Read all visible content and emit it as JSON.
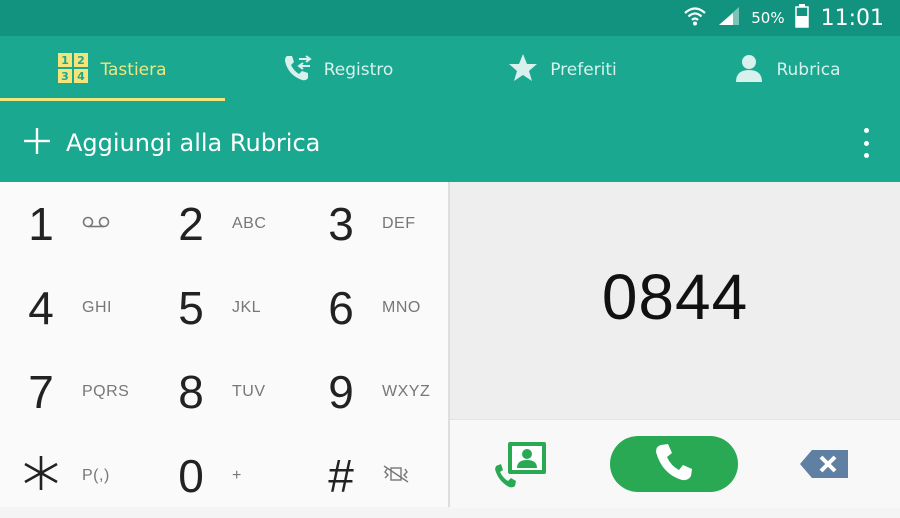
{
  "status_bar": {
    "battery": "50%",
    "time": "11:01"
  },
  "tabs": [
    {
      "label": "Tastiera",
      "icon": "keypad-icon",
      "active": true
    },
    {
      "label": "Registro",
      "icon": "call-log-icon",
      "active": false
    },
    {
      "label": "Preferiti",
      "icon": "star-icon",
      "active": false
    },
    {
      "label": "Rubrica",
      "icon": "person-icon",
      "active": false
    }
  ],
  "keypad_tab_glyphs": [
    "1",
    "2",
    "3",
    "4"
  ],
  "action_bar": {
    "add_label": "Aggiungi alla Rubrica"
  },
  "keypad": {
    "keys": [
      {
        "digit": "1",
        "sub": ""
      },
      {
        "digit": "2",
        "sub": "ABC"
      },
      {
        "digit": "3",
        "sub": "DEF"
      },
      {
        "digit": "4",
        "sub": "GHI"
      },
      {
        "digit": "5",
        "sub": "JKL"
      },
      {
        "digit": "6",
        "sub": "MNO"
      },
      {
        "digit": "7",
        "sub": "PQRS"
      },
      {
        "digit": "8",
        "sub": "TUV"
      },
      {
        "digit": "9",
        "sub": "WXYZ"
      },
      {
        "digit": "",
        "sub": "P(,)"
      },
      {
        "digit": "0",
        "sub": "+"
      },
      {
        "digit": "#",
        "sub": ""
      }
    ]
  },
  "display": {
    "number": "0844"
  },
  "colors": {
    "status_bar": "#12937f",
    "header": "#1aa891",
    "active_tab": "#f3e57a",
    "call_button": "#2aa954",
    "backspace": "#5f7fa3"
  }
}
